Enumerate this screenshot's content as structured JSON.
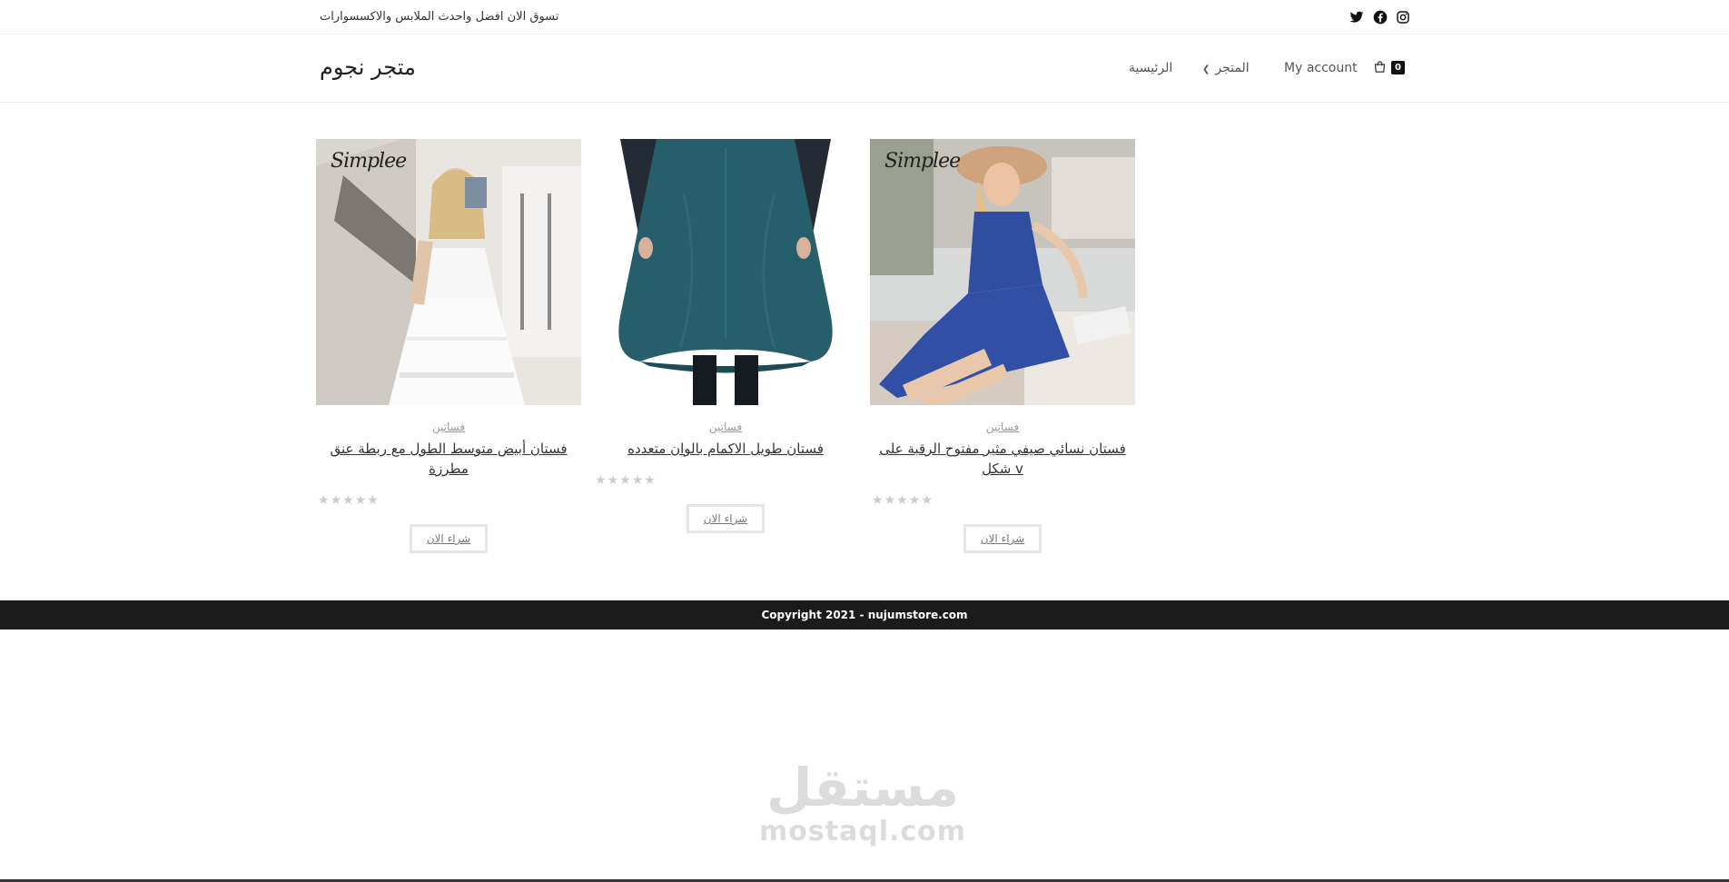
{
  "topbar": {
    "tagline": "تسوق الان افضل واحدث الملابس والاكسسوارات",
    "social_icons": [
      "twitter-icon",
      "facebook-icon",
      "instagram-icon"
    ]
  },
  "header": {
    "site_title": "متجر نجوم",
    "nav": {
      "home": "الرئيسية",
      "shop": "المتجر",
      "account": "My account"
    },
    "cart_count": "0"
  },
  "products": [
    {
      "category": "فساتين",
      "title": "فستان أبيض متوسط الطول مع ربطة عنق مطرزة",
      "brand_mark": "Simplee",
      "rating": 0,
      "rating_max": 5,
      "button": "شراء الان"
    },
    {
      "category": "فساتين",
      "title": "فستان طويل الاكمام بالوان متعدده",
      "rating": 0,
      "rating_max": 5,
      "button": "شراء الان"
    },
    {
      "category": "فساتين",
      "title": "فستان نسائي صيفي مثير مفتوح الرقبة على v شكل",
      "brand_mark": "Simplee",
      "rating": 0,
      "rating_max": 5,
      "button": "شراء الان"
    }
  ],
  "footer": {
    "copyright": "Copyright 2021 - nujumstore.com"
  },
  "watermark": {
    "arabic": "مستقل",
    "latin": "mostaql.com"
  },
  "colors": {
    "footer_bg": "#1b1b1b",
    "text": "#333333",
    "muted": "#999999",
    "star_empty": "#cccccc"
  }
}
